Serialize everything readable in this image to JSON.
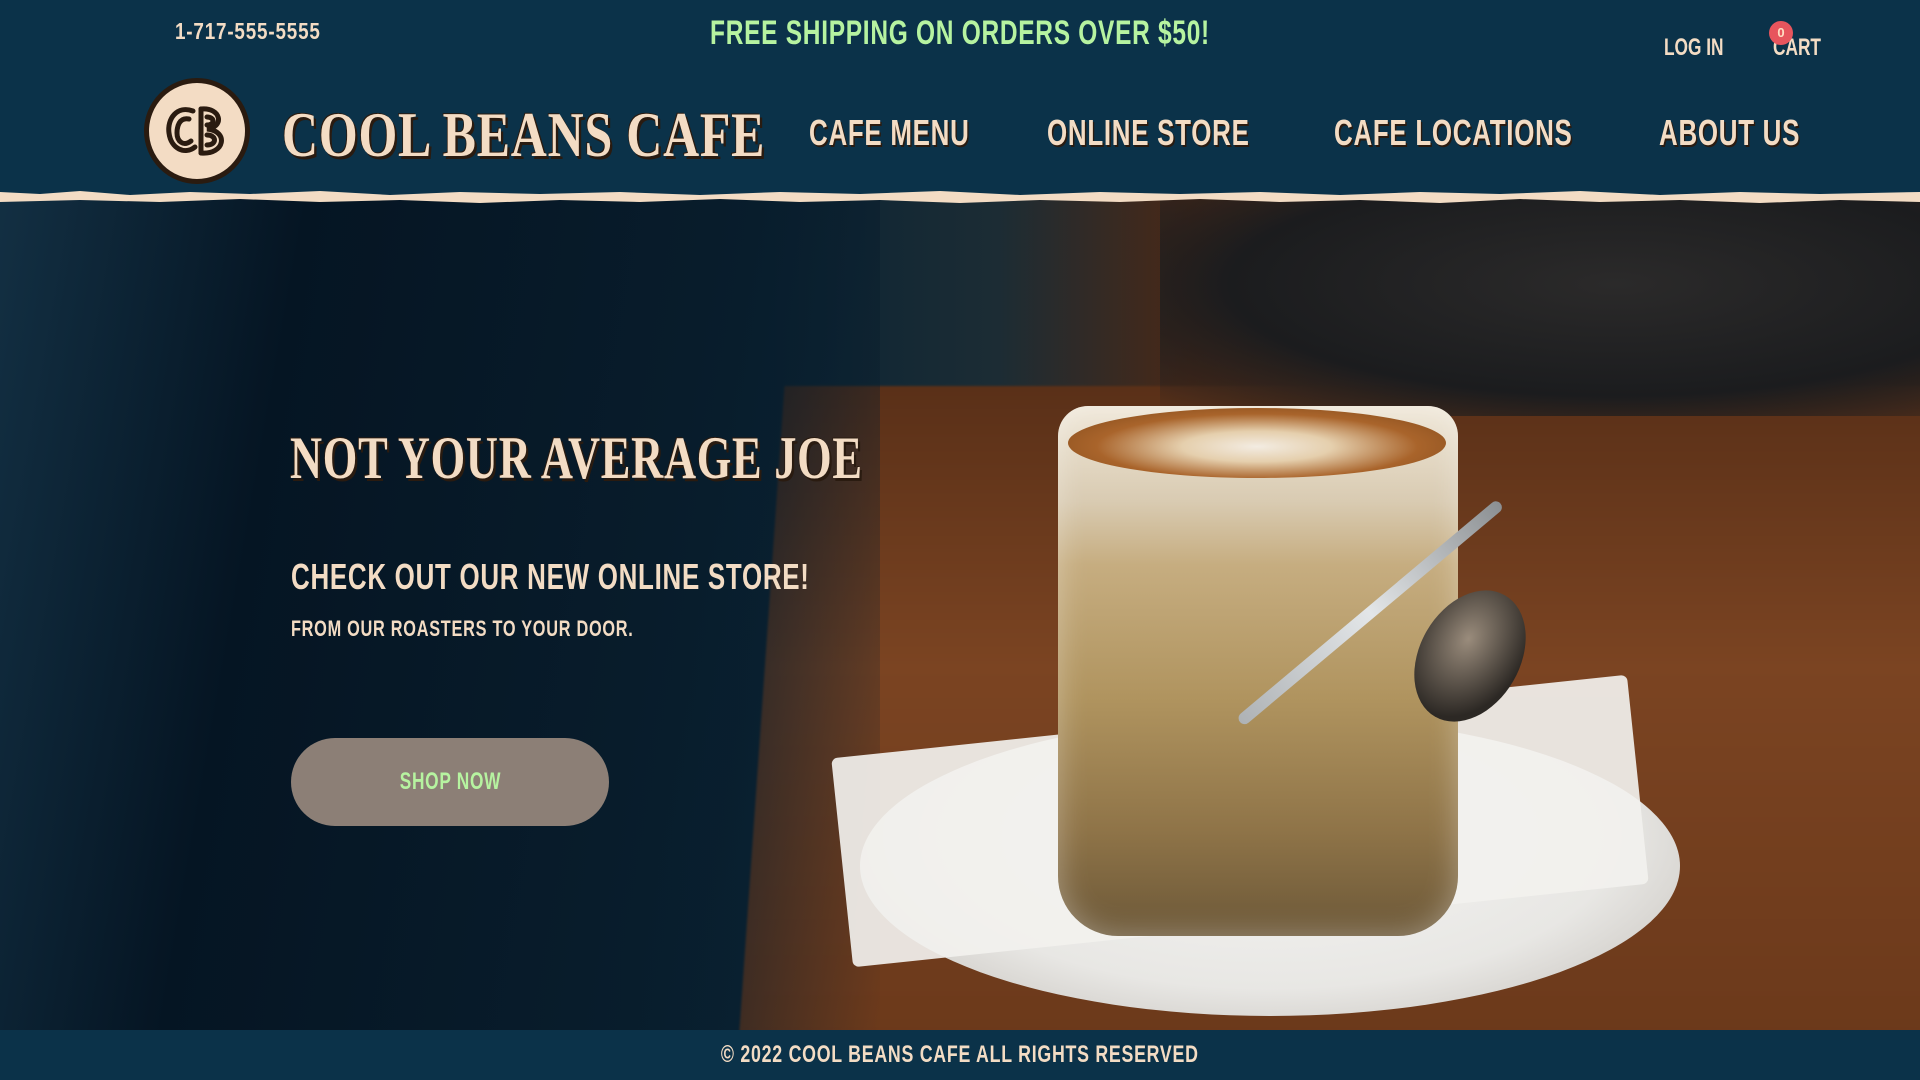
{
  "topbar": {
    "phone": "1-717-555-5555",
    "promo": "FREE SHIPPING ON ORDERS OVER $50!",
    "login_label": "LOG IN",
    "cart_label": "CART",
    "cart_count": "0"
  },
  "brand": {
    "logo_initials": "CB",
    "name": "COOL BEANS CAFE"
  },
  "nav": {
    "items": [
      {
        "label": "CAFE MENU"
      },
      {
        "label": "ONLINE STORE"
      },
      {
        "label": "CAFE LOCATIONS"
      },
      {
        "label": "ABOUT US"
      }
    ]
  },
  "hero": {
    "title": "NOT YOUR AVERAGE JOE",
    "subtitle": "CHECK OUT OUR NEW ONLINE STORE!",
    "tagline": "FROM OUR ROASTERS TO YOUR DOOR.",
    "cta_label": "SHOP NOW",
    "image": "latte-in-glass-on-saucer-photo"
  },
  "footer": {
    "copyright": "© 2022 COOL BEANS CAFE ALL RIGHTS RESERVED"
  },
  "colors": {
    "navy": "#0b3249",
    "cream": "#f3dcc4",
    "mint": "#b6f3a0",
    "badge_red": "#e7555d",
    "button_taupe": "#8c7f76"
  },
  "icons": {
    "logo": "cb-monogram-logo-icon"
  }
}
